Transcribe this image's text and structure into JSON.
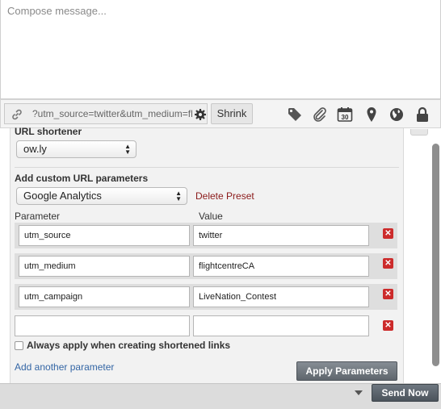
{
  "compose": {
    "placeholder": "Compose message..."
  },
  "link_toolbar": {
    "url_value": "?utm_source=twitter&utm_medium=fl",
    "shrink_label": "Shrink",
    "icons": [
      "link-icon",
      "gear-icon",
      "tag-icon",
      "paperclip-icon",
      "calendar-icon",
      "location-pin-icon",
      "globe-icon",
      "lock-icon"
    ],
    "calendar_day": "30"
  },
  "url_shortener": {
    "label": "URL shortener",
    "selected": "ow.ly"
  },
  "custom_params": {
    "heading": "Add custom URL parameters",
    "preset_selected": "Google Analytics",
    "delete_preset_label": "Delete Preset",
    "col_parameter": "Parameter",
    "col_value": "Value",
    "rows": [
      {
        "parameter": "utm_source",
        "value": "twitter"
      },
      {
        "parameter": "utm_medium",
        "value": "flightcentreCA"
      },
      {
        "parameter": "utm_campaign",
        "value": "LiveNation_Contest"
      },
      {
        "parameter": "",
        "value": ""
      }
    ],
    "always_apply_label": "Always apply when creating shortened links",
    "add_another_label": "Add another parameter",
    "apply_label": "Apply Parameters"
  },
  "footer": {
    "send_label": "Send Now"
  },
  "colors": {
    "accent_link": "#3466a5",
    "delete_red": "#cc2b2b",
    "delete_preset": "#8b1a1a"
  }
}
